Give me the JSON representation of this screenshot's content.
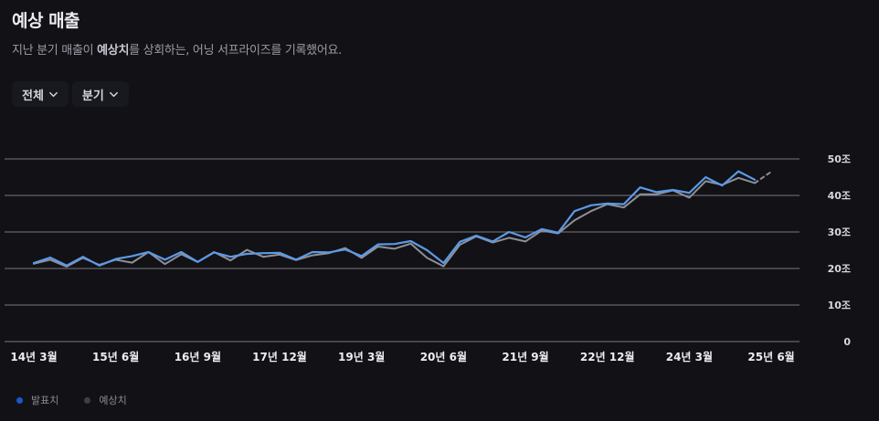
{
  "header": {
    "title": "예상 매출",
    "subtitle_prefix": "지난 분기 매출이 ",
    "subtitle_bold": "예상치",
    "subtitle_suffix": "를 상회하는, 어닝 서프라이즈를 기록했어요."
  },
  "filters": [
    {
      "label": "전체",
      "icon": "chevron-down-icon"
    },
    {
      "label": "분기",
      "icon": "chevron-down-icon"
    }
  ],
  "colors": {
    "background": "#111116",
    "actual": "#5b9ae6",
    "estimate": "#8f8f97",
    "legend_actual_dot": "#1e56c9",
    "legend_estimate_dot": "#3e3e46",
    "grid": "#9a9aa3"
  },
  "legend": [
    {
      "label": "발표치",
      "key": "actual"
    },
    {
      "label": "예상치",
      "key": "estimate"
    }
  ],
  "chart_data": {
    "type": "line",
    "title": "예상 매출",
    "y_axis_side": "right",
    "yticks": [
      50,
      40,
      30,
      20,
      10,
      0
    ],
    "ytick_labels": [
      "50조",
      "40조",
      "30조",
      "20조",
      "10조",
      "0"
    ],
    "ylim": [
      0,
      50
    ],
    "grid": true,
    "xtick_labels": [
      "14년 3월",
      "15년 6월",
      "16년 9월",
      "17년 12월",
      "19년 3월",
      "20년 6월",
      "21년 9월",
      "22년 12월",
      "24년 3월",
      "25년 6월"
    ],
    "x": [
      "14.Q1",
      "14.Q2",
      "14.Q3",
      "14.Q4",
      "15.Q1",
      "15.Q2",
      "15.Q3",
      "15.Q4",
      "16.Q1",
      "16.Q2",
      "16.Q3",
      "16.Q4",
      "17.Q1",
      "17.Q2",
      "17.Q3",
      "17.Q4",
      "18.Q1",
      "18.Q2",
      "18.Q3",
      "18.Q4",
      "19.Q1",
      "19.Q2",
      "19.Q3",
      "19.Q4",
      "20.Q1",
      "20.Q2",
      "20.Q3",
      "20.Q4",
      "21.Q1",
      "21.Q2",
      "21.Q3",
      "21.Q4",
      "22.Q1",
      "22.Q2",
      "22.Q3",
      "22.Q4",
      "23.Q1",
      "23.Q2",
      "23.Q3",
      "23.Q4",
      "24.Q1",
      "24.Q2",
      "24.Q3",
      "24.Q4",
      "25.Q1",
      "25.Q2",
      "25.Q3"
    ],
    "series": [
      {
        "name": "발표치",
        "key": "actual",
        "values": [
          21.5,
          23.0,
          20.8,
          23.2,
          20.8,
          22.6,
          23.4,
          24.5,
          22.4,
          24.5,
          21.8,
          24.4,
          23.2,
          24.0,
          24.2,
          24.3,
          22.4,
          24.5,
          24.4,
          25.2,
          23.4,
          26.6,
          26.7,
          27.5,
          25.0,
          21.5,
          27.3,
          29.0,
          27.4,
          30.0,
          28.5,
          30.8,
          29.8,
          35.7,
          37.3,
          37.8,
          37.6,
          42.2,
          40.9,
          41.5,
          40.7,
          45.0,
          42.7,
          46.6,
          44.3,
          null,
          null
        ]
      },
      {
        "name": "예상치",
        "key": "estimate",
        "values": [
          21.3,
          22.4,
          20.5,
          22.9,
          21.0,
          22.4,
          21.6,
          24.5,
          21.2,
          23.9,
          21.8,
          24.5,
          22.2,
          25.1,
          23.2,
          23.8,
          22.3,
          23.6,
          24.2,
          25.6,
          22.9,
          26.0,
          25.4,
          26.8,
          22.9,
          20.6,
          26.5,
          28.8,
          27.1,
          28.4,
          27.4,
          30.4,
          29.6,
          33.2,
          35.7,
          37.6,
          36.7,
          40.3,
          40.3,
          41.4,
          39.4,
          43.9,
          42.9,
          44.8,
          43.4,
          46.5,
          null
        ]
      }
    ],
    "estimate_forecast_from_index": 44
  }
}
